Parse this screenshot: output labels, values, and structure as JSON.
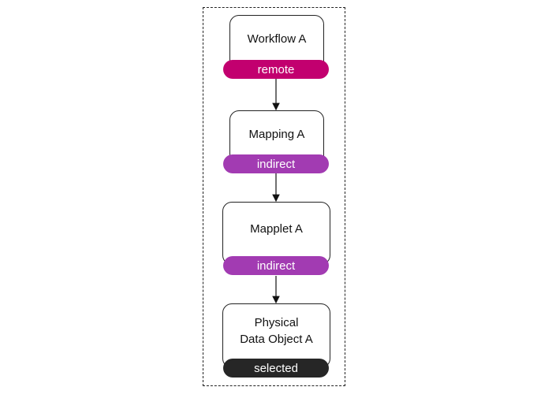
{
  "diagram": {
    "nodes": [
      {
        "label": "Workflow A",
        "badge": "remote",
        "badge_color": "#c2006f"
      },
      {
        "label": "Mapping A",
        "badge": "indirect",
        "badge_color": "#a23bb2"
      },
      {
        "label": "Mapplet A",
        "badge": "indirect",
        "badge_color": "#a23bb2"
      },
      {
        "label": "Physical\nData Object A",
        "badge": "selected",
        "badge_color": "#262626"
      }
    ],
    "edges": [
      {
        "from": "Workflow A",
        "to": "Mapping A"
      },
      {
        "from": "Mapping A",
        "to": "Mapplet A"
      },
      {
        "from": "Mapplet A",
        "to": "Physical Data Object A"
      }
    ]
  }
}
